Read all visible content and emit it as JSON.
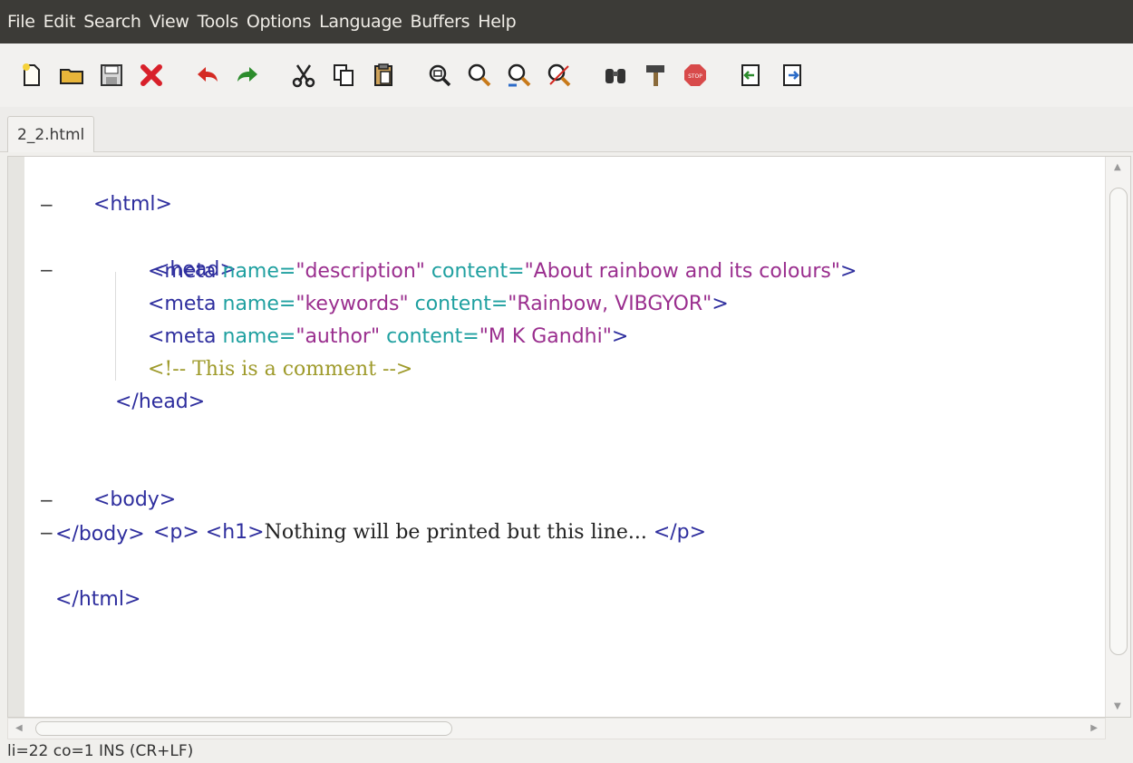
{
  "menubar": {
    "items": [
      "File",
      "Edit",
      "Search",
      "View",
      "Tools",
      "Options",
      "Language",
      "Buffers",
      "Help"
    ]
  },
  "toolbar": {
    "buttons": [
      {
        "icon": "new-file-icon"
      },
      {
        "icon": "open-folder-icon"
      },
      {
        "icon": "save-icon"
      },
      {
        "icon": "close-red-x-icon"
      },
      {
        "icon": "undo-icon"
      },
      {
        "icon": "redo-icon"
      },
      {
        "icon": "cut-icon"
      },
      {
        "icon": "copy-icon"
      },
      {
        "icon": "paste-icon"
      },
      {
        "icon": "zoom-fit-icon"
      },
      {
        "icon": "zoom-in-icon"
      },
      {
        "icon": "zoom-out-icon"
      },
      {
        "icon": "zoom-reset-icon"
      },
      {
        "icon": "find-binoculars-icon"
      },
      {
        "icon": "build-hammer-icon"
      },
      {
        "icon": "stop-icon"
      },
      {
        "icon": "previous-buffer-icon"
      },
      {
        "icon": "next-buffer-icon"
      }
    ],
    "stop_text": "STOP"
  },
  "tab": {
    "label": "2_2.html"
  },
  "editor": {
    "lines": {
      "l1": "<html>",
      "l3": "<head>",
      "l4_tag": "<meta ",
      "l4_attr1": "name=",
      "l4_val1": "\"description\" ",
      "l4_attr2": "content=",
      "l4_val2": "\"About rainbow and its colours\"",
      "l4_end": ">",
      "l5_tag": "<meta ",
      "l5_attr1": "name=",
      "l5_val1": "\"keywords\" ",
      "l5_attr2": "content=",
      "l5_val2": "\"Rainbow, VIBGYOR\"",
      "l5_end": ">",
      "l6_tag": "<meta ",
      "l6_attr1": "name=",
      "l6_val1": "\"author\" ",
      "l6_attr2": "content=",
      "l6_val2": "\"M K Gandhi\"",
      "l6_end": ">",
      "l7": "<!-- This is a comment -->",
      "l8": "</head>",
      "l10": "<body>",
      "l11_p": "<p> ",
      "l11_h1": "<h1>",
      "l11_text": "Nothing will be printed but this line... ",
      "l11_close": "</p>",
      "l12": "</body>",
      "l14": "</html>"
    },
    "fold_marker": "−"
  },
  "status": {
    "text": "li=22 co=1 INS (CR+LF)"
  }
}
